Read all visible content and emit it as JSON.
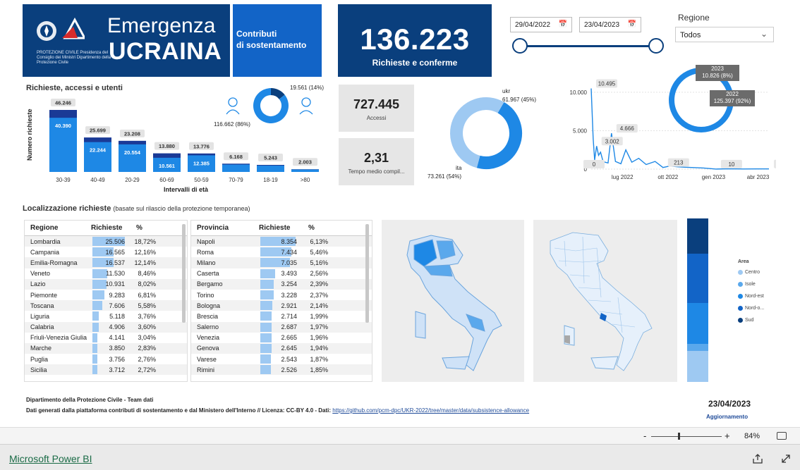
{
  "banner": {
    "title_line1": "Emergenza",
    "title_line2": "UCRAINA",
    "logo_text": "PROTEZIONE CIVILE Presidenza del Consiglio dei Ministri Dipartimento della Protezione Civile"
  },
  "contributi": {
    "line1": "Contributi",
    "line2": "di sostentamento"
  },
  "kpi_main": {
    "value": "136.223",
    "label": "Richieste e conferme"
  },
  "kpi_accessi": {
    "value": "727.445",
    "label": "Accessi"
  },
  "kpi_tempo": {
    "value": "2,31",
    "label": "Tempo medio compil..."
  },
  "filters": {
    "date_from": "29/04/2022",
    "date_to": "23/04/2023",
    "calendar_icon": "calendar-icon",
    "region_label": "Regione",
    "region_value": "Todos"
  },
  "colors": {
    "navy": "#0a3f7d",
    "blue": "#1264c7",
    "mid_blue": "#1e88e5",
    "light_blue": "#9ec9f2",
    "dark_bar": "#1a3a96"
  },
  "age_chart": {
    "title": "Richieste, accessi e utenti",
    "ylabel": "Numero richieste",
    "xlabel": "Intervalli di età",
    "categories": [
      "30-39",
      "40-49",
      "20-29",
      "60-69",
      "50-59",
      "70-79",
      "18-19",
      ">80"
    ],
    "total_labels": [
      "46.246",
      "25.699",
      "23.208",
      "13.880",
      "13.776",
      "6.168",
      "5.243",
      "2.003"
    ],
    "inner_labels": [
      "40.390",
      "22.244",
      "20.554",
      "10.561",
      "12.385",
      "",
      "",
      ""
    ],
    "totals": [
      46246,
      25699,
      23208,
      13880,
      13776,
      6168,
      5243,
      2003
    ],
    "inner": [
      40390,
      22244,
      20554,
      10561,
      12385,
      5500,
      4700,
      1800
    ]
  },
  "gender_donut": {
    "label_small": "19.561 (14%)",
    "label_large": "116.662 (86%)",
    "values": [
      19561,
      116662
    ]
  },
  "country_donut": {
    "label_ukr_name": "ukr",
    "label_ukr_value": "61.967 (45%)",
    "label_ita_name": "ita",
    "label_ita_value": "73.261 (54%)",
    "values": [
      61967,
      73261
    ]
  },
  "chart_data": {
    "type": "line",
    "x": [
      "2022-04-29",
      "2022-05-03",
      "2022-05-06",
      "2022-05-10",
      "2022-05-14",
      "2022-05-18",
      "2022-05-23",
      "2022-05-27",
      "2022-06-02",
      "2022-06-09",
      "2022-06-17",
      "2022-06-28",
      "2022-07-08",
      "2022-07-20",
      "2022-08-03",
      "2022-08-18",
      "2022-09-05",
      "2022-09-21",
      "2022-10-05",
      "2022-10-20",
      "2022-11-04",
      "2022-11-22",
      "2022-12-12",
      "2023-01-06",
      "2023-02-01",
      "2023-03-01",
      "2023-03-30",
      "2023-04-23"
    ],
    "values": [
      10495,
      4000,
      1200,
      3002,
      1800,
      2200,
      1000,
      900,
      800,
      4666,
      1000,
      700,
      2500,
      900,
      1400,
      600,
      1000,
      213,
      400,
      300,
      250,
      200,
      150,
      10,
      40,
      20,
      30,
      24
    ],
    "data_labels": [
      "10.495",
      "3.002",
      "4.666",
      "213",
      "10",
      "24",
      "0"
    ],
    "y_ticks": [
      "10.000",
      "5.000",
      "0"
    ],
    "x_ticks": [
      "lug 2022",
      "ott 2022",
      "gen 2023",
      "abr 2023"
    ],
    "ylim": [
      0,
      11000
    ],
    "grid": true
  },
  "year_donut": {
    "label_2023_year": "2023",
    "label_2023_value": "10.826 (8%)",
    "label_2022_year": "2022",
    "label_2022_value": "125.397 (92%)",
    "values": [
      10826,
      125397
    ]
  },
  "localizzazione": {
    "title": "Localizzazione richieste",
    "subtitle": "(basate sul rilascio della protezione temporanea)"
  },
  "table_regioni": {
    "headers": [
      "Regione",
      "Richieste",
      "%"
    ],
    "rows": [
      [
        "Lombardia",
        "25.506",
        "18,72%"
      ],
      [
        "Campania",
        "16.565",
        "12,16%"
      ],
      [
        "Emilia-Romagna",
        "16.537",
        "12,14%"
      ],
      [
        "Veneto",
        "11.530",
        "8,46%"
      ],
      [
        "Lazio",
        "10.931",
        "8,02%"
      ],
      [
        "Piemonte",
        "9.283",
        "6,81%"
      ],
      [
        "Toscana",
        "7.606",
        "5,58%"
      ],
      [
        "Liguria",
        "5.118",
        "3,76%"
      ],
      [
        "Calabria",
        "4.906",
        "3,60%"
      ],
      [
        "Friuli-Venezia Giulia",
        "4.141",
        "3,04%"
      ],
      [
        "Marche",
        "3.850",
        "2,83%"
      ],
      [
        "Puglia",
        "3.756",
        "2,76%"
      ],
      [
        "Sicilia",
        "3.712",
        "2,72%"
      ]
    ],
    "bar_values": [
      25506,
      16565,
      16537,
      11530,
      10931,
      9283,
      7606,
      5118,
      4906,
      4141,
      3850,
      3756,
      3712
    ]
  },
  "table_province": {
    "headers": [
      "Provincia",
      "Richieste",
      "%"
    ],
    "rows": [
      [
        "Napoli",
        "8.354",
        "6,13%"
      ],
      [
        "Roma",
        "7.434",
        "5,46%"
      ],
      [
        "Milano",
        "7.035",
        "5,16%"
      ],
      [
        "Caserta",
        "3.493",
        "2,56%"
      ],
      [
        "Bergamo",
        "3.254",
        "2,39%"
      ],
      [
        "Torino",
        "3.228",
        "2,37%"
      ],
      [
        "Bologna",
        "2.921",
        "2,14%"
      ],
      [
        "Brescia",
        "2.714",
        "1,99%"
      ],
      [
        "Salerno",
        "2.687",
        "1,97%"
      ],
      [
        "Venezia",
        "2.665",
        "1,96%"
      ],
      [
        "Genova",
        "2.645",
        "1,94%"
      ],
      [
        "Varese",
        "2.543",
        "1,87%"
      ],
      [
        "Rimini",
        "2.526",
        "1,85%"
      ]
    ],
    "bar_values": [
      8354,
      7434,
      7035,
      3493,
      3254,
      3228,
      2921,
      2714,
      2687,
      2665,
      2645,
      2543,
      2526
    ]
  },
  "legend": {
    "title": "Area",
    "items": [
      "Centro",
      "Isole",
      "Nord-est",
      "Nord-o...",
      "Sud"
    ],
    "colors": [
      "#9ec9f2",
      "#5aa8ec",
      "#1e88e5",
      "#1264c7",
      "#0a3f7d"
    ]
  },
  "footer": {
    "line1": "Dipartimento della Protezione Civile - Team dati",
    "line2": "Dati generati dalla piattaforma contributi di sostentamento e dal Ministero dell'Interno // Licenza: CC-BY 4.0 - Dati: ",
    "link": "https://github.com/pcm-dpc/UKR-2022/tree/master/data/subsistence-allowance",
    "update_date": "23/04/2023",
    "update_label": "Aggiornamento"
  },
  "statusbar": {
    "zoom": "84%",
    "minus": "-",
    "plus": "+"
  },
  "bottombar": {
    "brand": "Microsoft Power BI"
  }
}
